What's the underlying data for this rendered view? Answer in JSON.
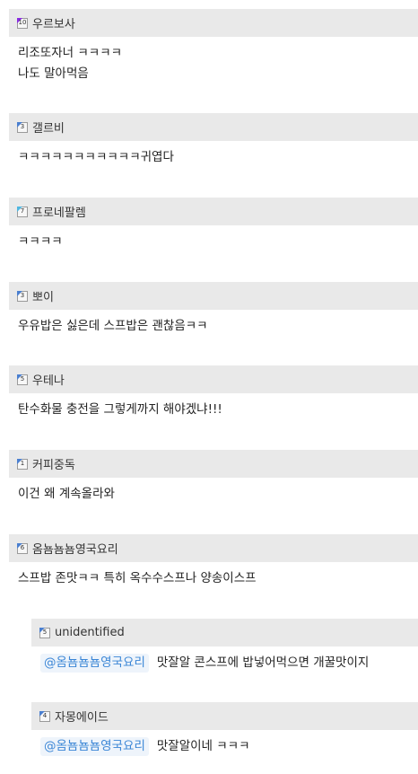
{
  "comments": [
    {
      "level": "10",
      "level_color": "#8a2be2",
      "nickname": "우르보사",
      "lines": [
        "리조또자너 ㅋㅋㅋㅋ",
        "나도 말아먹음"
      ]
    },
    {
      "level": "3",
      "level_color": "#4a7fd0",
      "nickname": "갤르비",
      "lines": [
        "ㅋㅋㅋㅋㅋㅋㅋㅋㅋㅋㅋ귀엽다"
      ]
    },
    {
      "level": "7",
      "level_color": "#4fb6e0",
      "nickname": "프로네팔렘",
      "lines": [
        "ㅋㅋㅋㅋ"
      ]
    },
    {
      "level": "3",
      "level_color": "#4a7fd0",
      "nickname": "뽀이",
      "lines": [
        "우유밥은 싫은데 스프밥은 괜찮음ㅋㅋ"
      ]
    },
    {
      "level": "5",
      "level_color": "#4a7fd0",
      "nickname": "우테나",
      "lines": [
        "탄수화물 충전을 그렇게까지 해야겠냐!!!"
      ]
    },
    {
      "level": "1",
      "level_color": "#4a7fd0",
      "nickname": "커피중독",
      "lines": [
        "이건 왜 계속올라와"
      ]
    },
    {
      "level": "6",
      "level_color": "#4a7fd0",
      "nickname": "옴뇸뇸뇸영국요리",
      "lines": [
        "스프밥 존맛ㅋㅋ 특히 옥수수스프나 양송이스프"
      ]
    }
  ],
  "replies": [
    {
      "level": "5",
      "level_color": "#4a7fd0",
      "nickname": "unidentified",
      "mention": "@옴뇸뇸뇸영국요리",
      "text": "맛잘알 콘스프에 밥넣어먹으면 개꿀맛이지"
    },
    {
      "level": "4",
      "level_color": "#4a7fd0",
      "nickname": "자몽에이드",
      "mention": "@옴뇸뇸뇸영국요리",
      "text": "맛잘알이네 ㅋㅋㅋ"
    }
  ]
}
